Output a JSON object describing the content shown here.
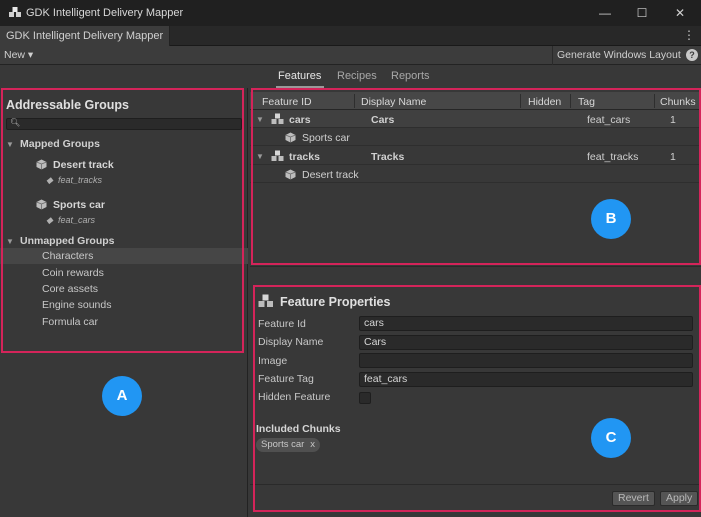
{
  "window": {
    "title": "GDK Intelligent Delivery Mapper",
    "tab_label": "GDK Intelligent Delivery Mapper",
    "minimize_glyph": "—",
    "maximize_glyph": "☐",
    "close_glyph": "✕",
    "kebab_glyph": "⋮"
  },
  "toolbar": {
    "new_label": "New ▾",
    "generate_layout_label": "Generate Windows Layout",
    "help_glyph": "?"
  },
  "view_tabs": {
    "features": "Features",
    "recipes": "Recipes",
    "reports": "Reports",
    "active": "Features"
  },
  "left_panel": {
    "title": "Addressable Groups",
    "search_placeholder": "",
    "mapped_header": "Mapped Groups",
    "mapped_items": [
      {
        "name": "Desert track",
        "tag": "feat_tracks"
      },
      {
        "name": "Sports car",
        "tag": "feat_cars"
      }
    ],
    "unmapped_header": "Unmapped Groups",
    "unmapped_items": [
      "Characters",
      "Coin rewards",
      "Core assets",
      "Engine sounds",
      "Formula car"
    ],
    "selected_unmapped": "Characters"
  },
  "table": {
    "columns": [
      "Feature ID",
      "Display Name",
      "Hidden",
      "Tag",
      "Chunks"
    ],
    "rows": [
      {
        "id": "cars",
        "display_name": "Cars",
        "tag": "feat_cars",
        "chunks": "1",
        "child": "Sports car"
      },
      {
        "id": "tracks",
        "display_name": "Tracks",
        "tag": "feat_tracks",
        "chunks": "1",
        "child": "Desert track"
      }
    ]
  },
  "properties": {
    "title": "Feature Properties",
    "fields": [
      {
        "label": "Feature Id",
        "value": "cars"
      },
      {
        "label": "Display Name",
        "value": "Cars"
      },
      {
        "label": "Image",
        "value": ""
      },
      {
        "label": "Feature Tag",
        "value": "feat_cars"
      }
    ],
    "hidden_label": "Hidden Feature",
    "hidden_checked": false,
    "included_chunks_label": "Included Chunks",
    "chunks": [
      {
        "name": "Sports car",
        "remove_glyph": "x"
      }
    ],
    "revert_label": "Revert",
    "apply_label": "Apply"
  },
  "annotations": {
    "a": "A",
    "b": "B",
    "c": "C",
    "box_color": "#d4245a",
    "badge_color": "#2196f3"
  },
  "icons": {
    "app": "app-cubes-icon",
    "group": "cube-icon",
    "feature": "cubes-icon",
    "tag": "tag-icon",
    "search": "search-icon"
  }
}
